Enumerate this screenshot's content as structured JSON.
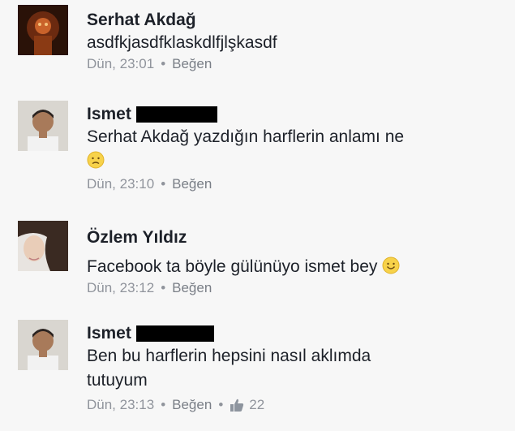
{
  "comments": [
    {
      "author": "Serhat Akdağ",
      "text": "asdfkjasdfklaskdlfjlşkasdf",
      "time": "Dün, 23:01",
      "like": "Beğen"
    },
    {
      "author": "Ismet",
      "text": "Serhat Akdağ yazdığın harflerin anlamı ne",
      "emoji": "sad-face-emoji",
      "time": "Dün, 23:10",
      "like": "Beğen"
    },
    {
      "author": "Özlem Yıldız",
      "text": "Facebook ta böyle gülünüyo ismet bey",
      "emoji": "smile-emoji",
      "time": "Dün, 23:12",
      "like": "Beğen"
    },
    {
      "author": "Ismet",
      "text": "Ben bu harflerin hepsini nasıl aklımda tutuyum",
      "time": "Dün, 23:13",
      "like": "Beğen",
      "reaction_count": "22",
      "reaction_icon": "thumbs-up-icon"
    }
  ],
  "separator": "•",
  "colors": {
    "text": "#1d2129",
    "meta": "#90949c",
    "background": "#f7f7f7",
    "redaction": "#000000"
  }
}
